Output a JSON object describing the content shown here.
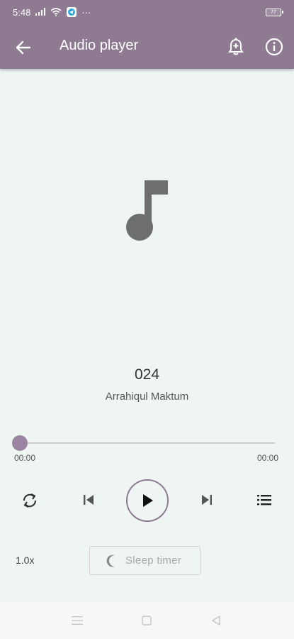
{
  "status_bar": {
    "time": "5:48",
    "battery": "77",
    "more": "···"
  },
  "app_bar": {
    "title": "Audio player"
  },
  "track": {
    "title": "024",
    "artist": "Arrahiqul Maktum"
  },
  "progress": {
    "current": "00:00",
    "total": "00:00",
    "fraction": 0
  },
  "controls": {
    "speed": "1.0x",
    "sleep_timer": "Sleep timer"
  },
  "colors": {
    "primary": "#8e7b92",
    "background": "#eff5f3",
    "icon_dark": "#6e6e6e"
  },
  "icons": [
    "back-arrow",
    "bell-plus",
    "info",
    "music-note",
    "repeat",
    "skip-previous",
    "play",
    "skip-next",
    "queue-list",
    "moon",
    "nav-menu",
    "nav-home",
    "nav-back"
  ]
}
